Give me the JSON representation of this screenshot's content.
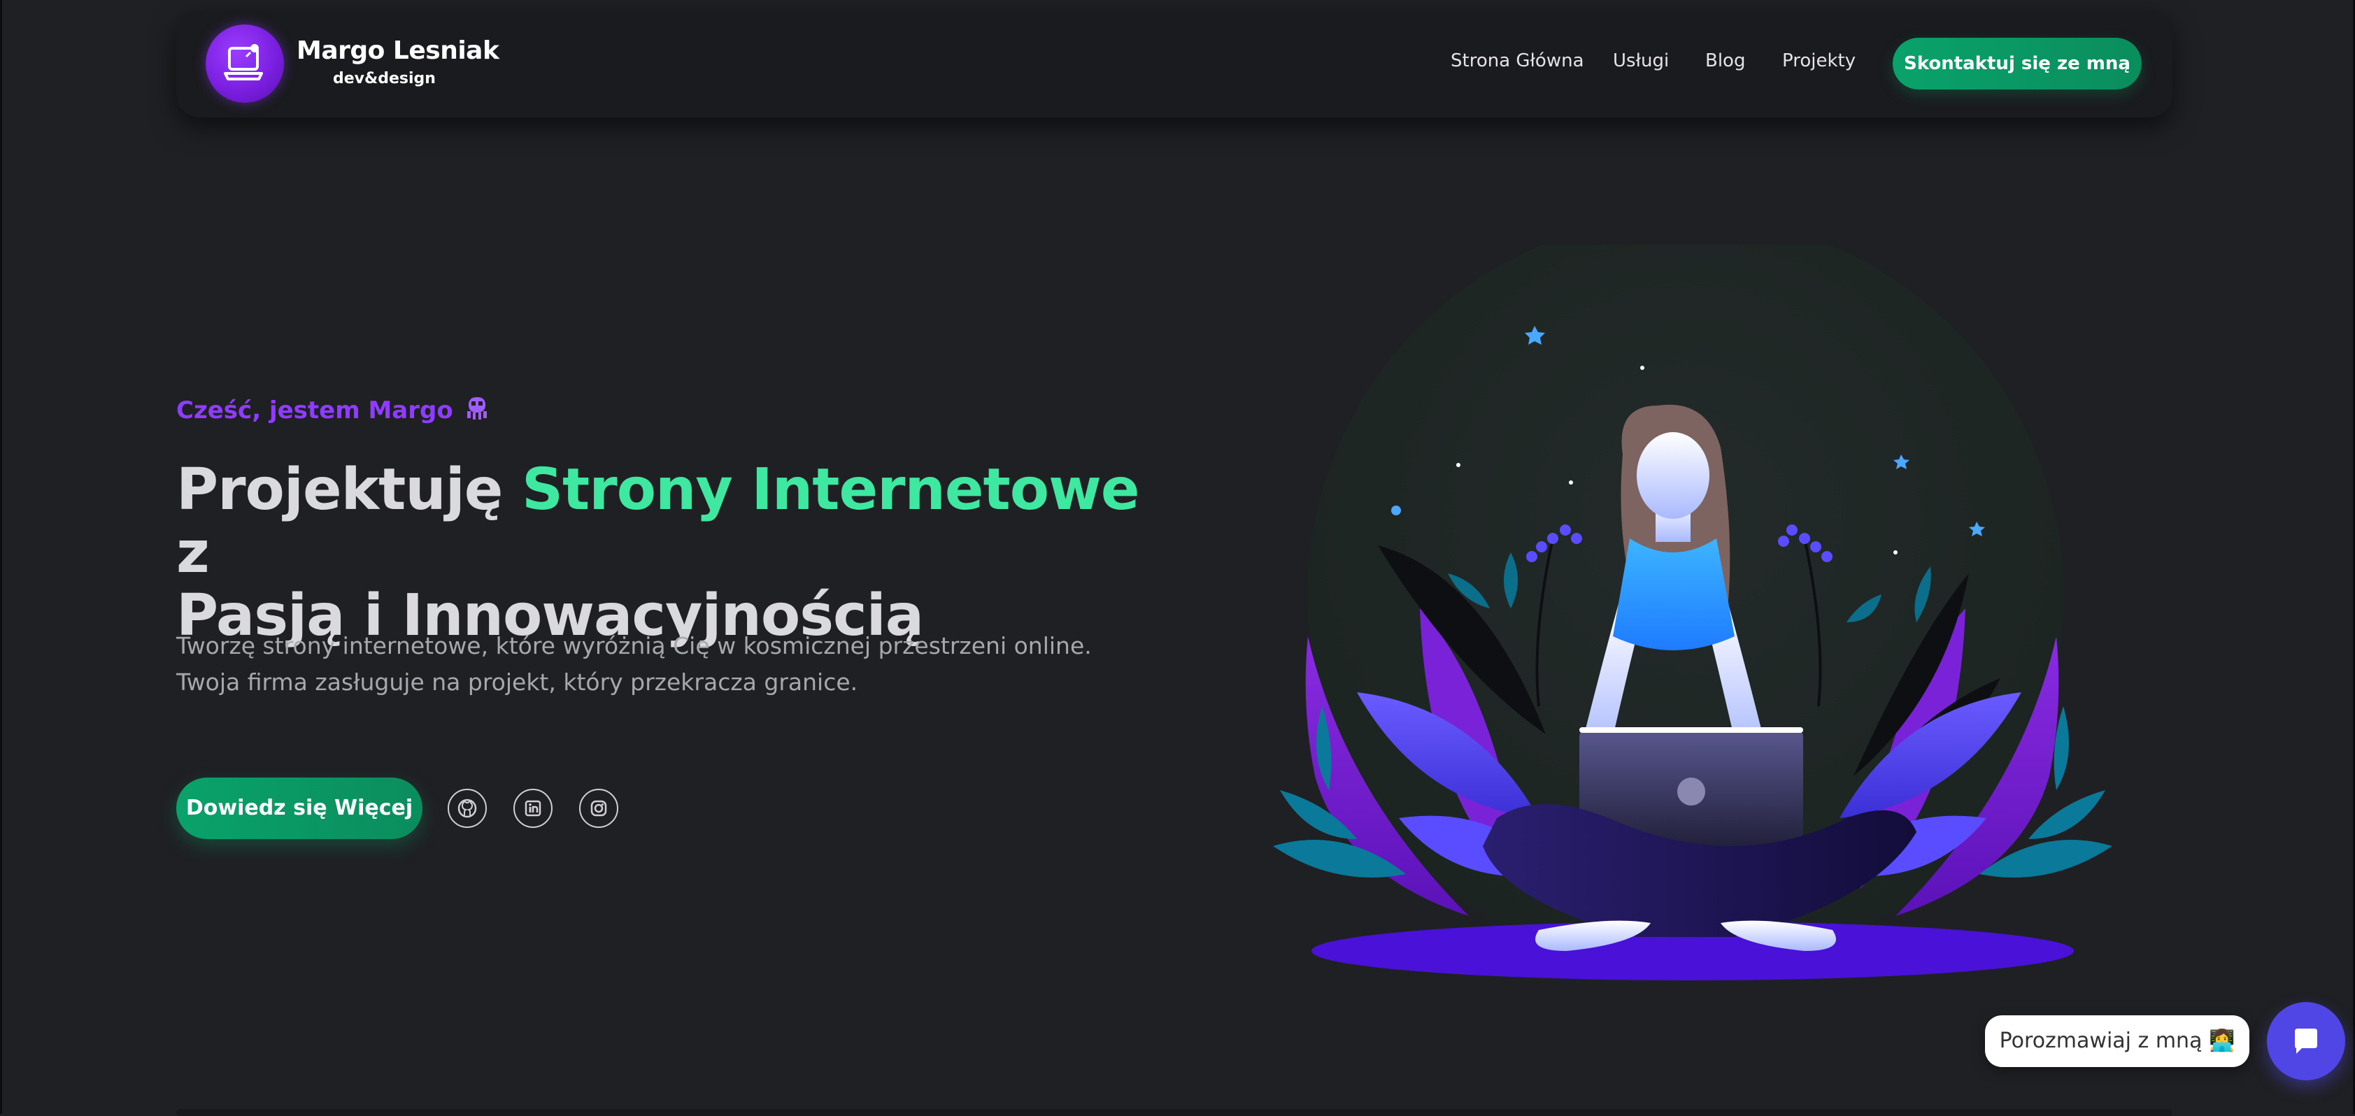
{
  "brand": {
    "name": "Margo Lesniak",
    "tagline": "dev&design"
  },
  "nav": {
    "items": [
      {
        "label": "Strona Główna"
      },
      {
        "label": "Usługi"
      },
      {
        "label": "Blog"
      },
      {
        "label": "Projekty"
      }
    ],
    "cta_label": "Skontaktuj się ze mną"
  },
  "hero": {
    "greeting": "Cześć, jestem Margo",
    "greeting_icon": "alien-monster-icon",
    "headline_part1": "Projektuję",
    "headline_accent": "Strony Internetowe",
    "headline_part2": "z",
    "headline_line2": "Pasją i Innowacyjnością",
    "description_line1": "Tworzę strony internetowe, które wyróżnią Cię w kosmicznej przestrzeni online.",
    "description_line2": "Twoja firma zasługuje na projekt, który przekracza granice.",
    "button_label": "Dowiedz się Więcej",
    "social": [
      "github-icon",
      "linkedin-icon",
      "instagram-icon"
    ]
  },
  "chat": {
    "bubble_text": "Porozmawiaj z mną 👩‍💻",
    "button_icon": "chat-icon"
  },
  "colors": {
    "background": "#1f2023",
    "accent_purple": "#8f3cff",
    "accent_green": "#3ee8a0",
    "button_green": "#0aa26a",
    "chat_blue": "#4f46e5"
  }
}
